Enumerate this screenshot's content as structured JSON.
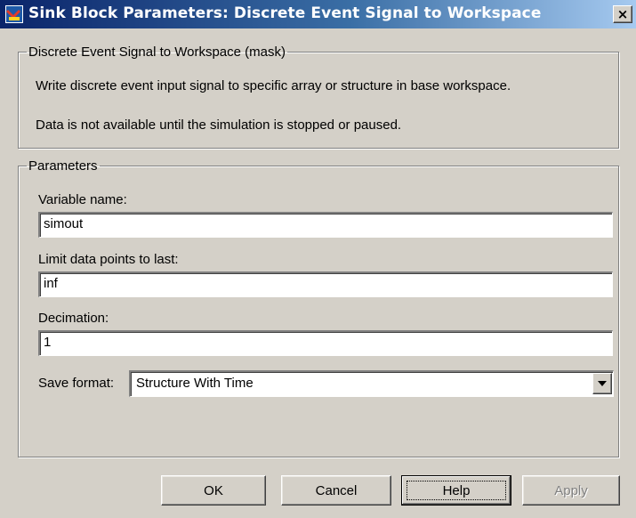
{
  "window": {
    "title": "Sink Block Parameters: Discrete Event Signal to Workspace",
    "close_glyph": "×",
    "titlebar_colors": [
      "#0a246a",
      "#a6caf0"
    ],
    "face_color": "#d4d0c8"
  },
  "mask_group": {
    "legend": "Discrete Event Signal to Workspace (mask)",
    "description_1": "Write discrete event input signal to specific array or structure in base workspace.",
    "description_2": "Data is not available until the simulation is stopped or paused."
  },
  "parameters": {
    "legend": "Parameters",
    "variable_name_label": "Variable name:",
    "variable_name_value": "simout",
    "limit_label": "Limit data points to last:",
    "limit_value": "inf",
    "decimation_label": "Decimation:",
    "decimation_value": "1",
    "save_format_label": "Save format:",
    "save_format_value": "Structure With Time"
  },
  "buttons": {
    "ok": "OK",
    "cancel": "Cancel",
    "help": "Help",
    "apply": "Apply"
  },
  "icons": {
    "app": "simulink-block-icon",
    "close": "close-icon",
    "dropdown": "chevron-down-icon"
  }
}
